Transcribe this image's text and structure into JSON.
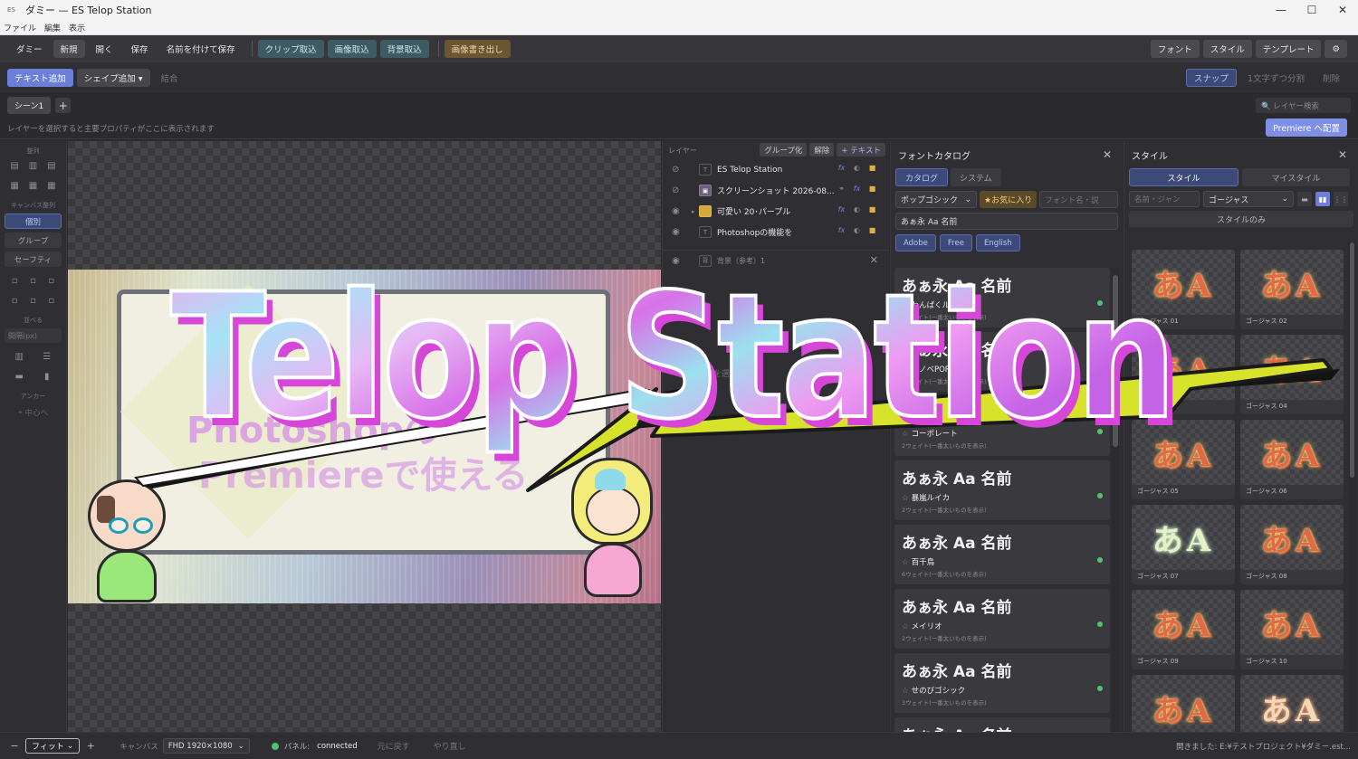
{
  "window": {
    "app_icon": "ES",
    "title": "ダミー — ES Telop Station",
    "controls": [
      "—",
      "☐",
      "✕"
    ]
  },
  "menubar": [
    "ファイル",
    "編集",
    "表示"
  ],
  "toolbar1": {
    "project_label": "ダミー",
    "new": "新規",
    "open": "開く",
    "save": "保存",
    "save_as": "名前を付けて保存",
    "clip_import": "クリップ取込",
    "image_import": "画像取込",
    "bg_import": "背景取込",
    "export_image": "画像書き出し",
    "font": "フォント",
    "style": "スタイル",
    "template": "テンプレート",
    "settings_icon": "⚙"
  },
  "toolbar2": {
    "add_text": "テキスト追加",
    "add_shape": "シェイプ追加 ▾",
    "merge": "結合",
    "snap": "スナップ",
    "split_chars": "1文字ずつ分割",
    "delete": "削除"
  },
  "scene_tabs": {
    "tabs": [
      "シーン1"
    ],
    "add": "+",
    "layer_search_placeholder": "🔍 レイヤー検索"
  },
  "hint": {
    "text": "レイヤーを選択すると主要プロパティがここに表示されます",
    "premiere_button": "Premiere へ配置"
  },
  "left_panel": {
    "align_label": "整列",
    "canvas_align_label": "キャンバス整列",
    "individual": "個別",
    "group": "グループ",
    "safe": "セーフティ",
    "spacing_label": "並べる",
    "spacing_placeholder": "間隔(px)",
    "anchor_label": "アンカー",
    "center": "中心へ"
  },
  "layers": {
    "title": "レイヤー",
    "group_btn": "グループ化",
    "ungroup_btn": "解除",
    "add_text_btn": "+ テキスト",
    "items": [
      {
        "name": "ES Telop Station",
        "kind": "T",
        "visible": false
      },
      {
        "name": "スクリーンショット 2026-08...",
        "kind": "img",
        "visible": false
      },
      {
        "name": "可愛い 20･パープル",
        "kind": "folder",
        "visible": true
      },
      {
        "name": "Photoshopの機能を",
        "kind": "T",
        "visible": true
      }
    ],
    "background": {
      "name": "背景（参考）1",
      "kind": "背"
    },
    "empty_hint": "レイヤーを選択..."
  },
  "font_catalog": {
    "title": "フォントカタログ",
    "tabs": [
      "カタログ",
      "システム"
    ],
    "category": "ポップゴシック",
    "favorites": "★お気に入り",
    "search_placeholder": "フォント名・説",
    "preview_text": "あぁ永 Aa 名前",
    "tags": [
      "Adobe",
      "Free",
      "English"
    ],
    "fonts": [
      {
        "sample": "あぁ永 Aa 名前",
        "name": "わんぱくルイカ",
        "weights": "1ウェイト(一番太いものを表示)"
      },
      {
        "sample": "あぁ永 Aa 名前",
        "name": "ラノベPOP",
        "weights": "1ウェイト(一番太いものを表示)"
      },
      {
        "sample": "あぁ永 Aa 名前",
        "name": "コーポレート",
        "weights": "2ウェイト(一番太いものを表示)"
      },
      {
        "sample": "あぁ永 Aa 名前",
        "name": "暴嵐ルイカ",
        "weights": "2ウェイト(一番太いものを表示)"
      },
      {
        "sample": "あぁ永 Aa 名前",
        "name": "百千鳥",
        "weights": "6ウェイト(一番太いものを表示)"
      },
      {
        "sample": "あぁ永 Aa 名前",
        "name": "メイリオ",
        "weights": "2ウェイト(一番太いものを表示)"
      },
      {
        "sample": "あぁ永 Aa 名前",
        "name": "せのびゴシック",
        "weights": "3ウェイト(一番太いものを表示)"
      },
      {
        "sample": "あぁ永 Aa 名前",
        "name": "",
        "weights": ""
      }
    ]
  },
  "style_panel": {
    "title": "スタイル",
    "tabs": [
      "スタイル",
      "マイスタイル"
    ],
    "search_placeholder": "名前・ジャン",
    "category": "ゴージャス",
    "style_only": "スタイルのみ",
    "styles": [
      {
        "label": "ゴージャス 01",
        "glyph": "あA"
      },
      {
        "label": "ゴージャス 02",
        "glyph": "あA"
      },
      {
        "label": "ゴージャス 03",
        "glyph": "あA"
      },
      {
        "label": "ゴージャス 04",
        "glyph": "あA"
      },
      {
        "label": "ゴージャス 05",
        "glyph": "あA"
      },
      {
        "label": "ゴージャス 06",
        "glyph": "あA"
      },
      {
        "label": "ゴージャス 07",
        "glyph": "あA"
      },
      {
        "label": "ゴージャス 08",
        "glyph": "あA"
      },
      {
        "label": "ゴージャス 09",
        "glyph": "あA"
      },
      {
        "label": "ゴージャス 10",
        "glyph": "あA"
      },
      {
        "label": "",
        "glyph": "あA"
      },
      {
        "label": "",
        "glyph": "あA"
      }
    ]
  },
  "overlay": {
    "title": "Telop Station"
  },
  "statusbar": {
    "zoom_minus": "−",
    "zoom": "フィット",
    "zoom_plus": "+",
    "canvas_label": "キャンバス",
    "canvas_size": "FHD 1920×1080",
    "panel_label": "パネル:",
    "connection": "connected",
    "undo": "元に戻す",
    "redo": "やり直し",
    "path": "開きました: E:¥テストプロジェクト¥ダミー.est..."
  },
  "colors": {
    "accent": "#6b7fd8",
    "connected": "#4ec473",
    "title_pink": "#e05ad8"
  }
}
